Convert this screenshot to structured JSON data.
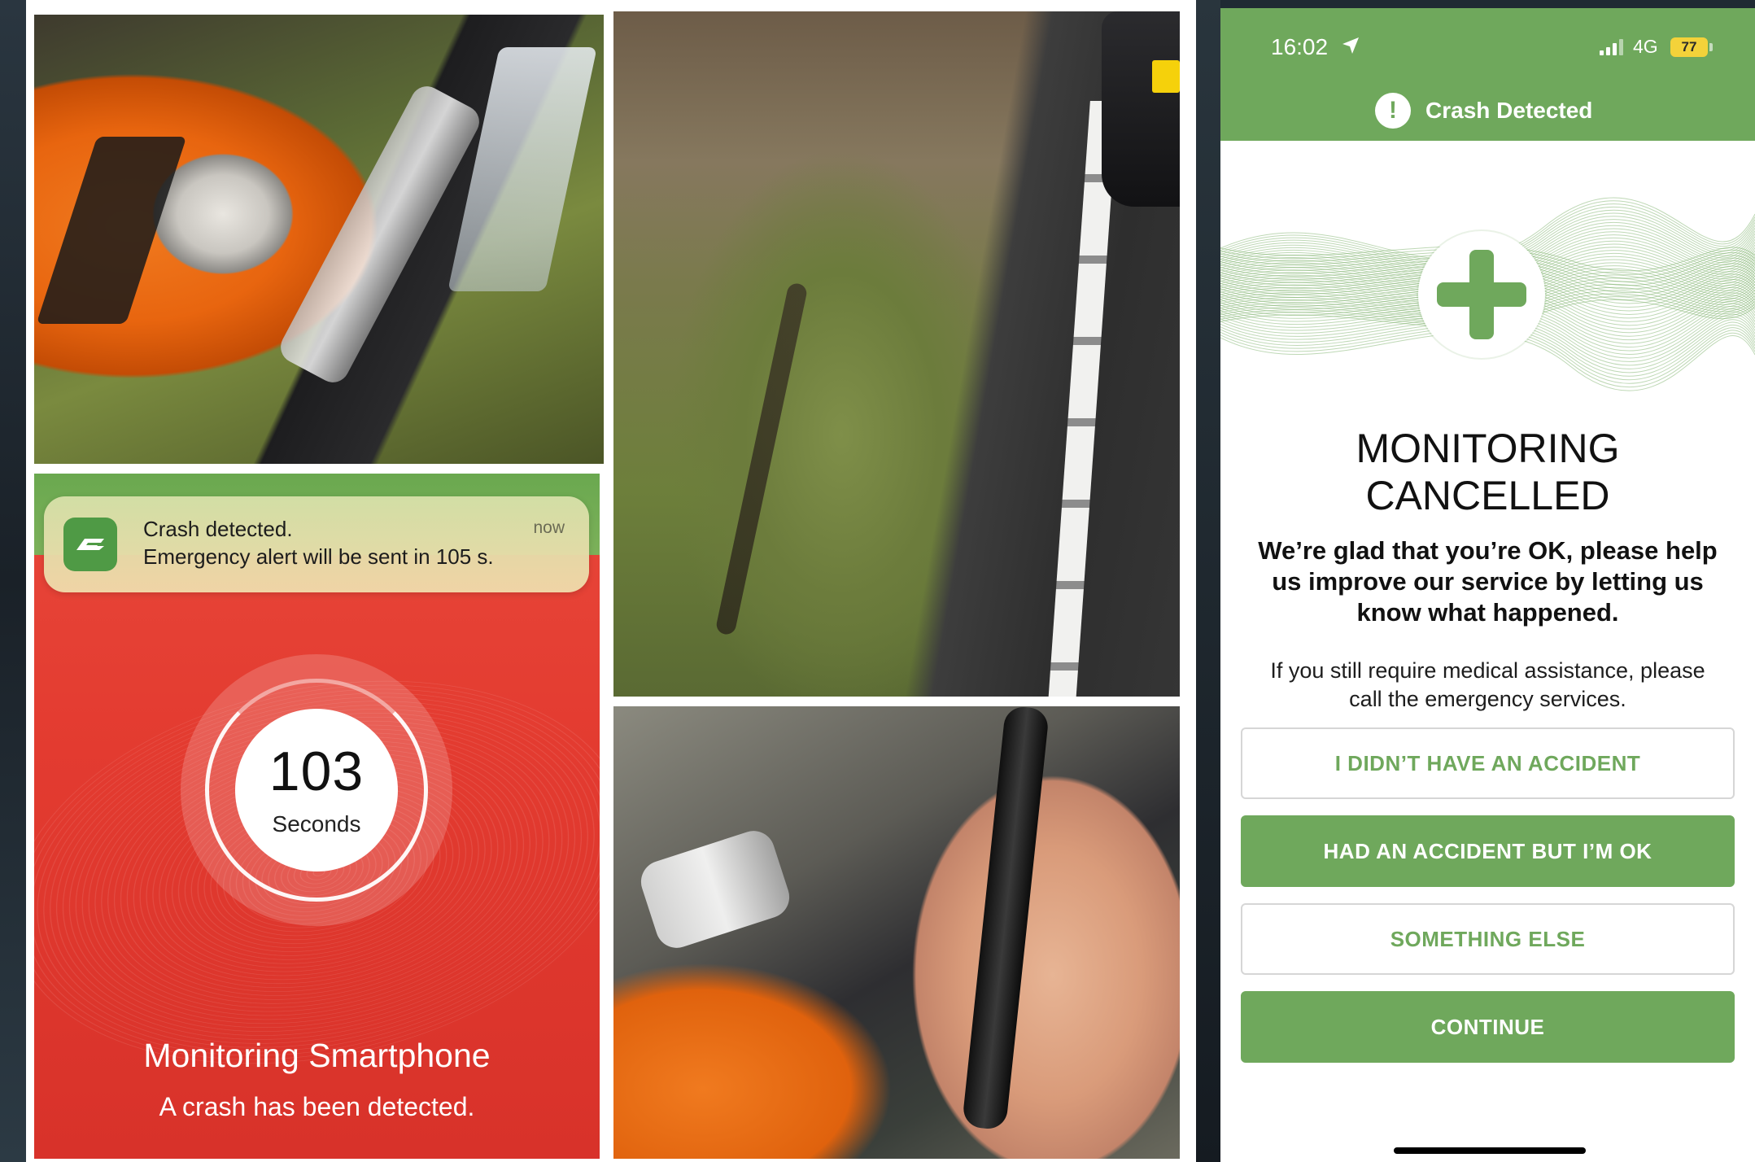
{
  "notification": {
    "title": "Crash detected.",
    "body": "Emergency alert will be sent in 105 s.",
    "time": "now"
  },
  "countdown": {
    "value": "103",
    "unit": "Seconds",
    "title": "Monitoring Smartphone",
    "subtitle": "A crash has been detected."
  },
  "status_bar": {
    "time": "16:02",
    "network": "4G",
    "battery": "77"
  },
  "header": {
    "title": "Crash Detected"
  },
  "result": {
    "title_line1": "MONITORING",
    "title_line2": "CANCELLED",
    "glad_message": "We’re glad that you’re OK, please help us improve our service by letting us know what happened.",
    "assist_message": "If you still require medical assistance, please call the emergency services."
  },
  "buttons": {
    "no_accident": "I DIDN’T HAVE AN ACCIDENT",
    "accident_ok": "HAD AN ACCIDENT BUT I’M OK",
    "something_else": "SOMETHING ELSE",
    "continue": "CONTINUE"
  },
  "colors": {
    "brand_green": "#6fa85c",
    "alert_red": "#e33b30",
    "battery_yellow": "#f3d23a"
  },
  "icons": {
    "location": "location-arrow-icon",
    "signal": "signal-bars-icon",
    "alert": "exclamation-circle-icon",
    "plus": "medical-plus-icon",
    "app": "app-logo-icon"
  }
}
